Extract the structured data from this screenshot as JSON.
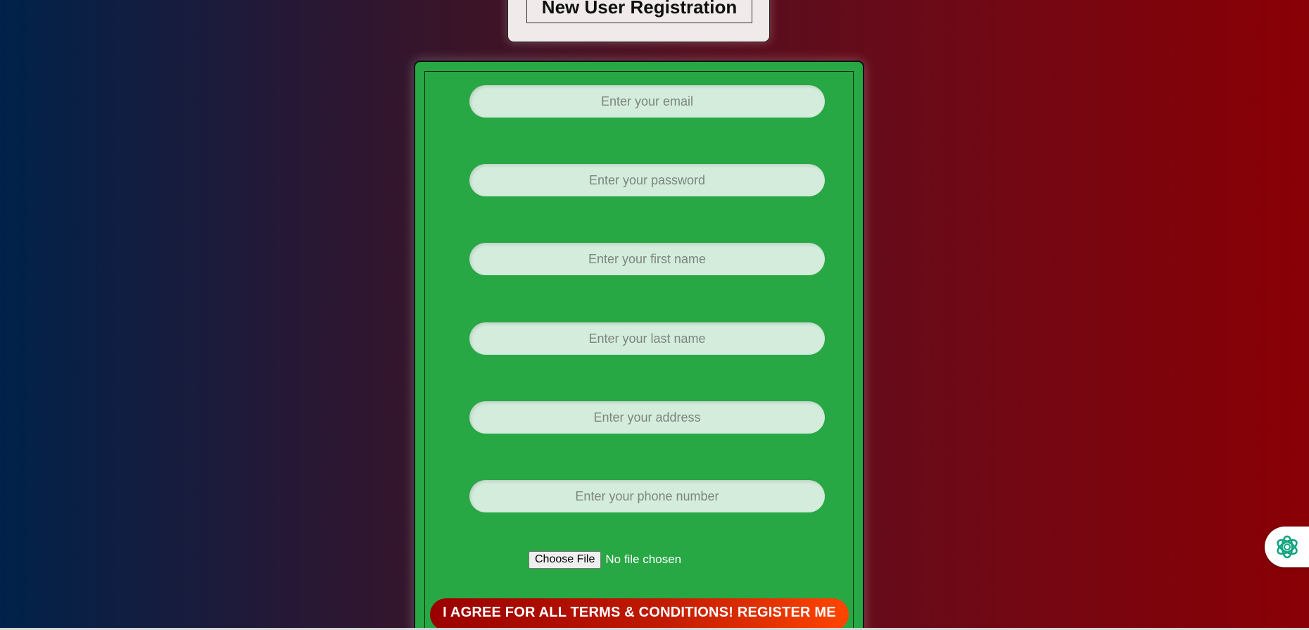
{
  "page": {
    "title": "New User Registration"
  },
  "form": {
    "fields": [
      {
        "name": "email",
        "placeholder": "Enter your email",
        "value": ""
      },
      {
        "name": "password",
        "placeholder": "Enter your password",
        "value": ""
      },
      {
        "name": "first_name",
        "placeholder": "Enter your first name",
        "value": ""
      },
      {
        "name": "last_name",
        "placeholder": "Enter your last name",
        "value": ""
      },
      {
        "name": "address",
        "placeholder": "Enter your address",
        "value": ""
      },
      {
        "name": "phone",
        "placeholder": "Enter your phone number",
        "value": ""
      }
    ],
    "file": {
      "button_label": "Choose File",
      "status": "No file chosen"
    },
    "submit_label": "I AGREE FOR ALL TERMS & CONDITIONS! REGISTER ME"
  },
  "assistant": {
    "icon": "openai-knot-icon",
    "color": "#10a37f"
  },
  "colors": {
    "form_bg": "#28a745",
    "field_bg": "#d4ecdc",
    "title_card_bg": "#f1eaea",
    "submit_gradient_start": "#9a0000",
    "submit_gradient_end": "#ff4500",
    "page_gradient_left": "#00224a",
    "page_gradient_right": "#8a0005"
  }
}
